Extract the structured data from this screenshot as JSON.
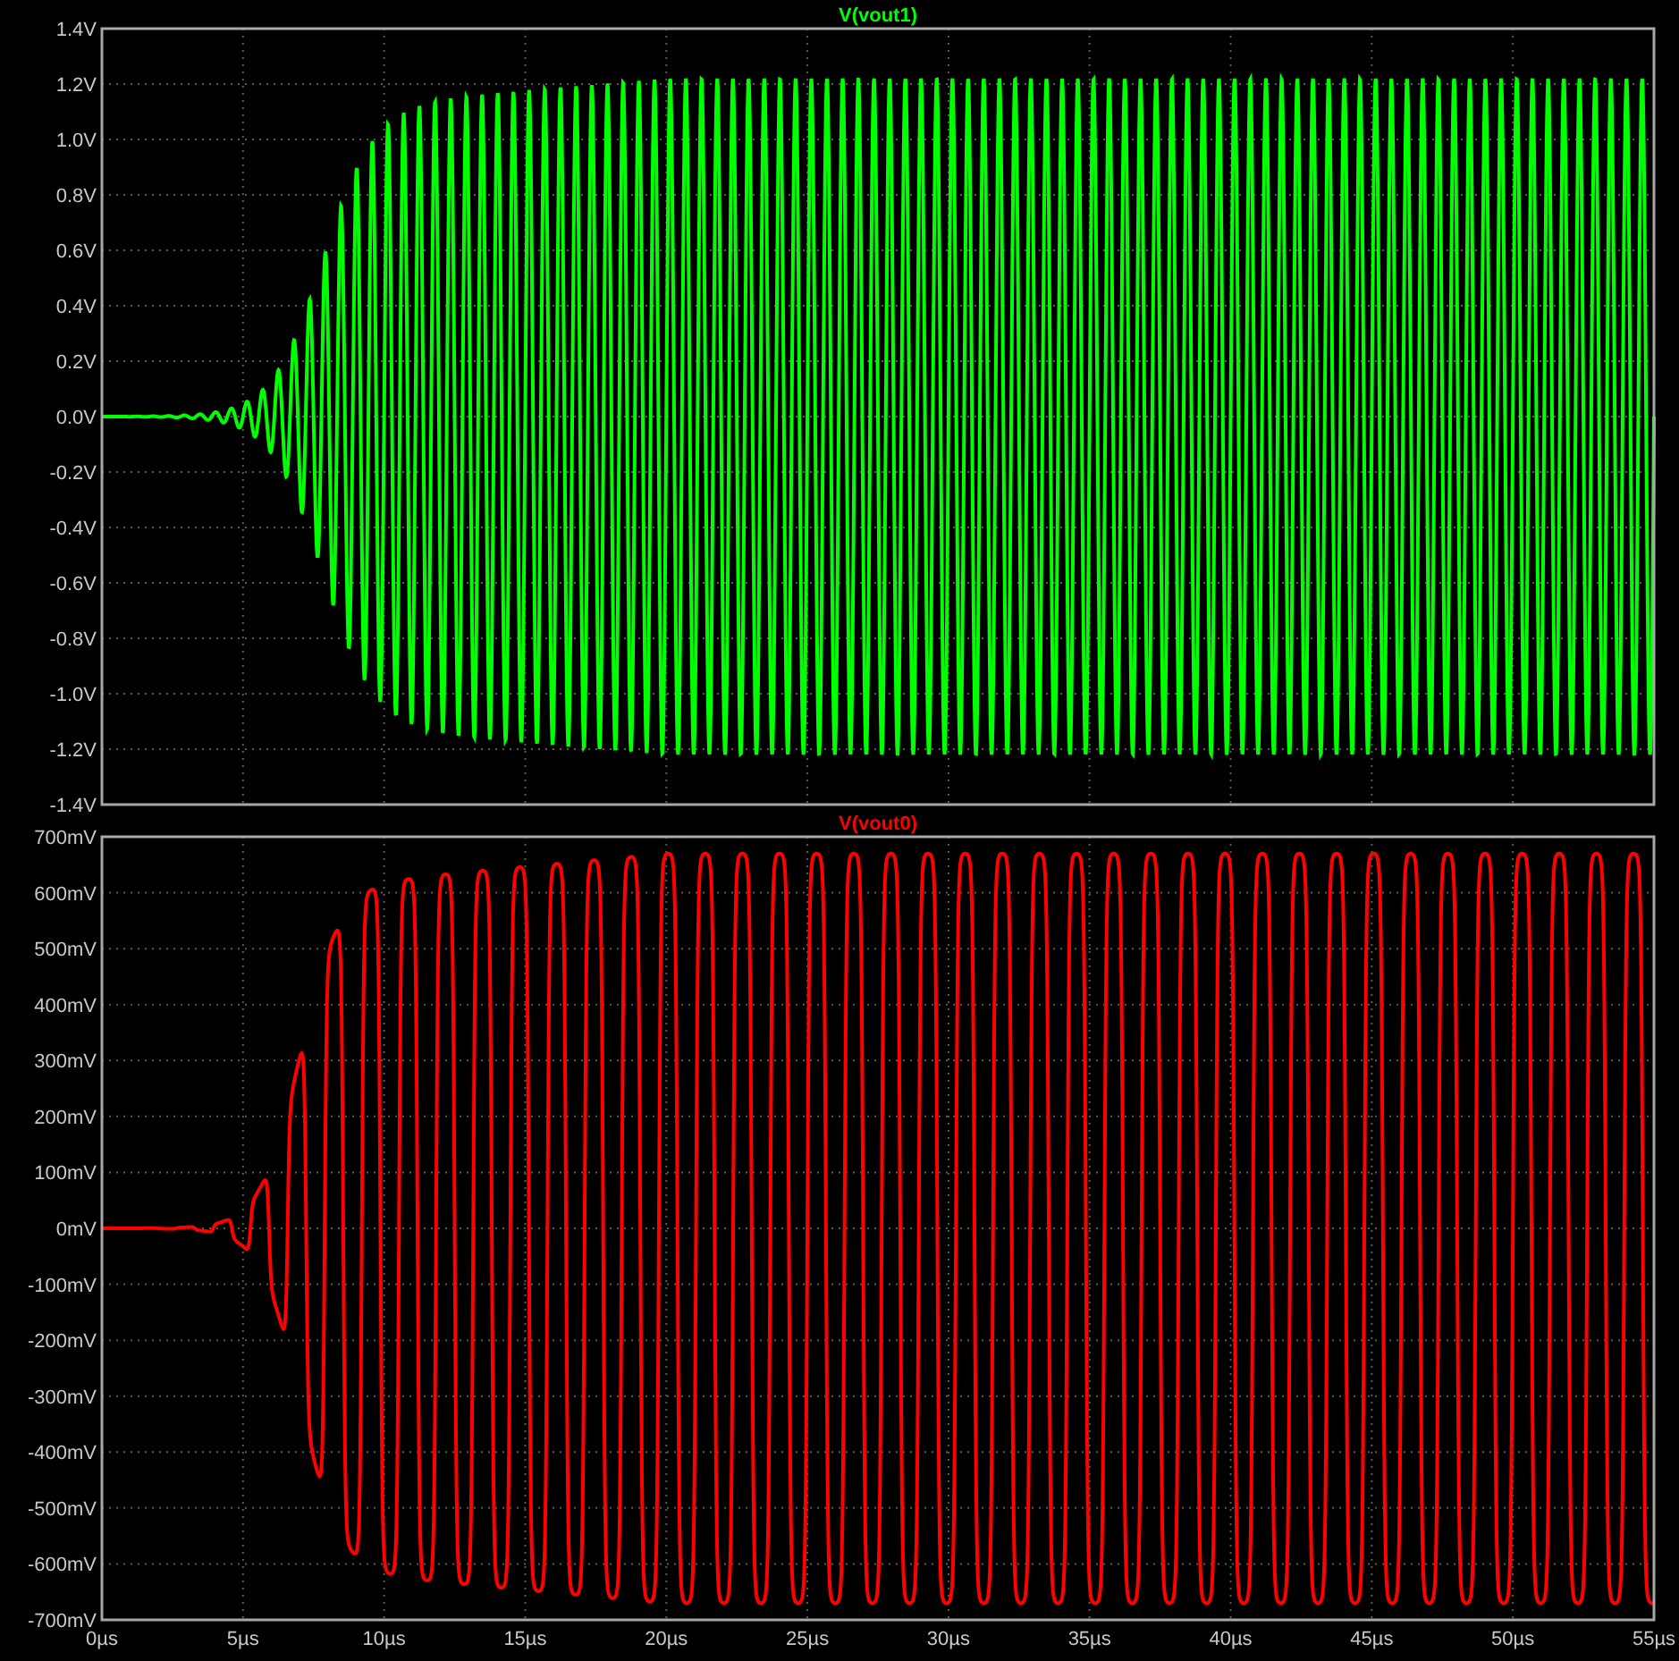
{
  "panels": [
    {
      "title": "V(vout1)",
      "color": "#00ff00",
      "kind": "sine",
      "y_labels": [
        "1.4V",
        "1.2V",
        "1.0V",
        "0.8V",
        "0.6V",
        "0.4V",
        "0.2V",
        "0.0V",
        "-0.2V",
        "-0.4V",
        "-0.6V",
        "-0.8V",
        "-1.0V",
        "-1.2V",
        "-1.4V"
      ]
    },
    {
      "title": "V(vout0)",
      "color": "#ff0000",
      "kind": "clipped",
      "y_labels": [
        "700mV",
        "600mV",
        "500mV",
        "400mV",
        "300mV",
        "200mV",
        "100mV",
        "0mV",
        "-100mV",
        "-200mV",
        "-300mV",
        "-400mV",
        "-500mV",
        "-600mV",
        "-700mV"
      ]
    }
  ],
  "x_labels": [
    "0µs",
    "5µs",
    "10µs",
    "15µs",
    "20µs",
    "25µs",
    "30µs",
    "35µs",
    "40µs",
    "45µs",
    "50µs",
    "55µs"
  ]
}
